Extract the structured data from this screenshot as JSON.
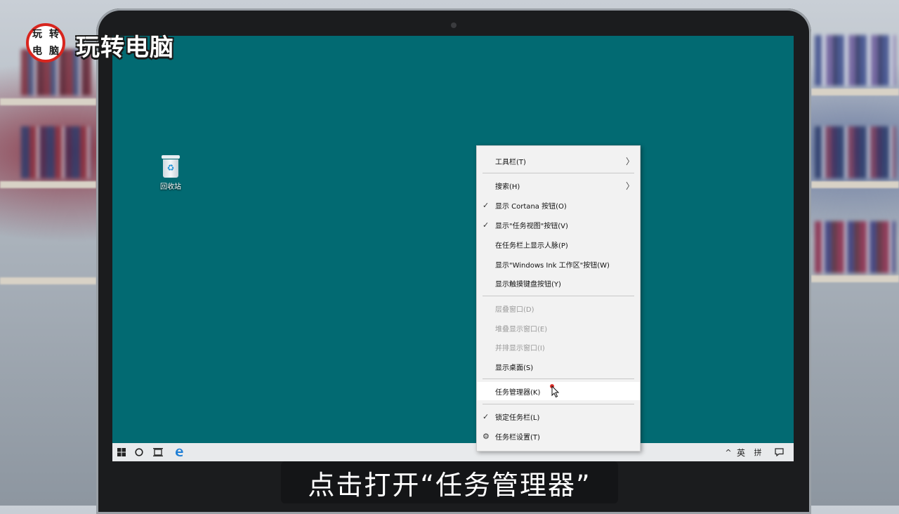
{
  "logo": {
    "badge_chars": [
      "玩",
      "转",
      "电",
      "脑"
    ],
    "text": "玩转电脑",
    "badge_ring_color": "#d8251e"
  },
  "desktop": {
    "background_color": "#026a72",
    "icons": [
      {
        "label": "回收站",
        "icon": "recycle-bin-icon"
      }
    ]
  },
  "context_menu": {
    "items": [
      {
        "id": "toolbar",
        "label": "工具栏(T)",
        "submenu": true,
        "checked": false,
        "enabled": true
      },
      {
        "id": "search",
        "label": "搜索(H)",
        "submenu": true,
        "checked": false,
        "enabled": true
      },
      {
        "id": "show-cortana",
        "label": "显示 Cortana 按钮(O)",
        "submenu": false,
        "checked": true,
        "enabled": true
      },
      {
        "id": "show-taskview",
        "label": "显示\"任务视图\"按钮(V)",
        "submenu": false,
        "checked": true,
        "enabled": true
      },
      {
        "id": "show-people",
        "label": "在任务栏上显示人脉(P)",
        "submenu": false,
        "checked": false,
        "enabled": true
      },
      {
        "id": "show-ink",
        "label": "显示\"Windows Ink 工作区\"按钮(W)",
        "submenu": false,
        "checked": false,
        "enabled": true
      },
      {
        "id": "show-keyboard",
        "label": "显示触摸键盘按钮(Y)",
        "submenu": false,
        "checked": false,
        "enabled": true
      },
      {
        "id": "cascade",
        "label": "层叠窗口(D)",
        "submenu": false,
        "checked": false,
        "enabled": false
      },
      {
        "id": "stack",
        "label": "堆叠显示窗口(E)",
        "submenu": false,
        "checked": false,
        "enabled": false
      },
      {
        "id": "side-by-side",
        "label": "并排显示窗口(I)",
        "submenu": false,
        "checked": false,
        "enabled": false
      },
      {
        "id": "show-desktop",
        "label": "显示桌面(S)",
        "submenu": false,
        "checked": false,
        "enabled": true
      },
      {
        "id": "task-manager",
        "label": "任务管理器(K)",
        "submenu": false,
        "checked": false,
        "enabled": true,
        "highlighted": true
      },
      {
        "id": "lock-taskbar",
        "label": "锁定任务栏(L)",
        "submenu": false,
        "checked": true,
        "enabled": true
      },
      {
        "id": "taskbar-settings",
        "label": "任务栏设置(T)",
        "submenu": false,
        "checked": false,
        "enabled": true,
        "icon": "gear-icon"
      }
    ]
  },
  "taskbar": {
    "left_icons": [
      "windows-start-icon",
      "cortana-circle-icon",
      "task-view-icon",
      "edge-icon"
    ],
    "tray": {
      "chevron": "^",
      "ime_lang": "英",
      "ime_mode": "拼",
      "notification_icon": "action-center-icon"
    }
  },
  "subtitle": {
    "text": "点击打开“任务管理器”"
  },
  "colors": {
    "menu_bg": "#f2f2f2",
    "cursor_highlight": "#e0302b"
  }
}
